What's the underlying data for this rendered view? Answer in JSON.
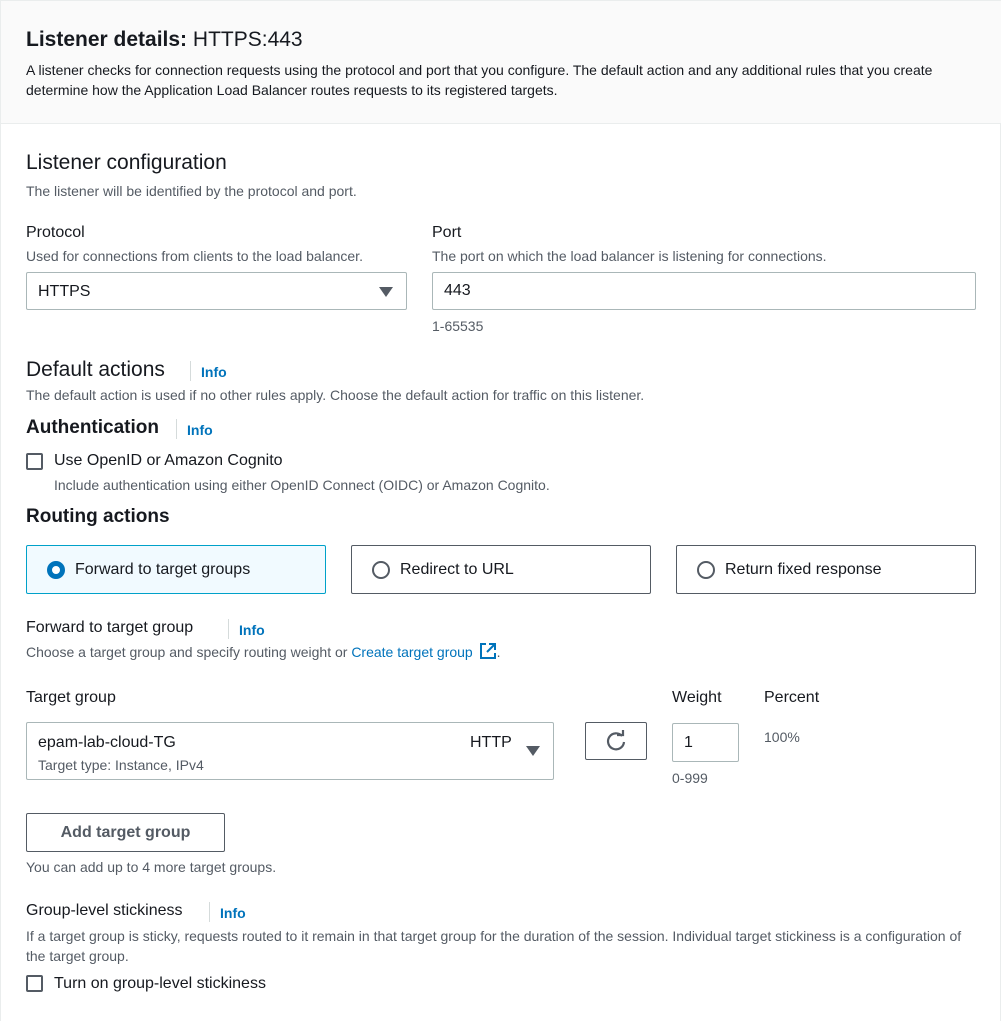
{
  "header": {
    "title_bold": "Listener details:",
    "title_value": "HTTPS:443",
    "description": "A listener checks for connection requests using the protocol and port that you configure. The default action and any additional rules that you create determine how the Application Load Balancer routes requests to its registered targets."
  },
  "listener_config": {
    "title": "Listener configuration",
    "description": "The listener will be identified by the protocol and port.",
    "protocol": {
      "label": "Protocol",
      "description": "Used for connections from clients to the load balancer.",
      "value": "HTTPS"
    },
    "port": {
      "label": "Port",
      "description": "The port on which the load balancer is listening for connections.",
      "value": "443",
      "hint": "1-65535"
    }
  },
  "default_actions": {
    "title": "Default actions",
    "info": "Info",
    "description": "The default action is used if no other rules apply. Choose the default action for traffic on this listener."
  },
  "authentication": {
    "title": "Authentication",
    "info": "Info",
    "checkbox_label": "Use OpenID or Amazon Cognito",
    "checkbox_checked": false,
    "checkbox_description": "Include authentication using either OpenID Connect (OIDC) or Amazon Cognito."
  },
  "routing_actions": {
    "title": "Routing actions",
    "options": [
      {
        "label": "Forward to target groups",
        "selected": true
      },
      {
        "label": "Redirect to URL",
        "selected": false
      },
      {
        "label": "Return fixed response",
        "selected": false
      }
    ]
  },
  "forward": {
    "title": "Forward to target group",
    "info": "Info",
    "description_prefix": "Choose a target group and specify routing weight or ",
    "create_link": "Create target group",
    "description_suffix": ".",
    "col_target_group": "Target group",
    "col_weight": "Weight",
    "col_percent": "Percent",
    "target_group": {
      "name": "epam-lab-cloud-TG",
      "protocol": "HTTP",
      "subtext": "Target type: Instance, IPv4"
    },
    "weight_value": "1",
    "weight_hint": "0-999",
    "percent_value": "100%",
    "add_button": "Add target group",
    "add_hint": "You can add up to 4 more target groups."
  },
  "stickiness": {
    "title": "Group-level stickiness",
    "info": "Info",
    "description": "If a target group is sticky, requests routed to it remain in that target group for the duration of the session. Individual target stickiness is a configuration of the target group.",
    "checkbox_label": "Turn on group-level stickiness",
    "checkbox_checked": false
  },
  "colors": {
    "link": "#0073bb",
    "selected_tile_bg": "#f1faff",
    "selected_tile_border": "#00a1c9",
    "header_bg": "#fafafa"
  }
}
